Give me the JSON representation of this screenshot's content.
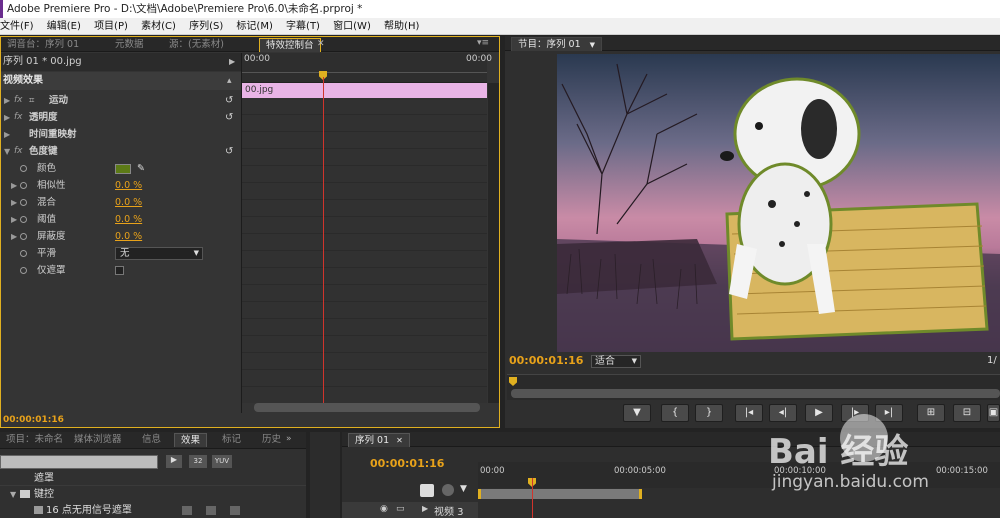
{
  "title_bar": "Adobe Premiere Pro - D:\\文档\\Adobe\\Premiere Pro\\6.0\\未命名.prproj *",
  "menu": [
    "文件(F)",
    "编辑(E)",
    "项目(P)",
    "素材(C)",
    "序列(S)",
    "标记(M)",
    "字幕(T)",
    "窗口(W)",
    "帮助(H)"
  ],
  "effect_panel": {
    "tabs": [
      "调音台：序列 01",
      "元数据",
      "源：(无素材)",
      "特效控制台"
    ],
    "sequence_label": "序列 01 * 00.jpg",
    "header": "视频效果",
    "ruler_start": "00:00",
    "ruler_end": "00:00",
    "clip_name": "00.jpg",
    "effects": [
      {
        "name": "运动",
        "kind": "effect"
      },
      {
        "name": "透明度",
        "kind": "effect"
      },
      {
        "name": "时间重映射",
        "kind": "effect"
      },
      {
        "name": "色度键",
        "kind": "effect"
      }
    ],
    "params": [
      {
        "name": "颜色",
        "value": ""
      },
      {
        "name": "相似性",
        "value": "0.0 %"
      },
      {
        "name": "混合",
        "value": "0.0 %"
      },
      {
        "name": "阈值",
        "value": "0.0 %"
      },
      {
        "name": "屏蔽度",
        "value": "0.0 %"
      },
      {
        "name": "平滑",
        "value": "无"
      },
      {
        "name": "仅遮罩",
        "value": ""
      }
    ],
    "timecode": "00:00:01:16",
    "key_color": "#5c7a16"
  },
  "program_monitor": {
    "tab": "节目：序列 01",
    "timecode": "00:00:01:16",
    "fit": "适合",
    "page": "1/"
  },
  "project_panel": {
    "tabs": [
      "项目：未命名",
      "媒体浏览器",
      "信息",
      "效果",
      "标记",
      "历史"
    ],
    "tree": [
      "遮罩",
      "键控",
      "16 点无用信号遮罩"
    ]
  },
  "timeline": {
    "tab": "序列 01",
    "timecode": "00:00:01:16",
    "ruler": [
      "00:00",
      "00:00:05:00",
      "00:00:10:00",
      "00:00:15:00"
    ],
    "track": "视频 3"
  },
  "watermark": {
    "brand": "Bai 经验",
    "url": "jingyan.baidu.com"
  }
}
